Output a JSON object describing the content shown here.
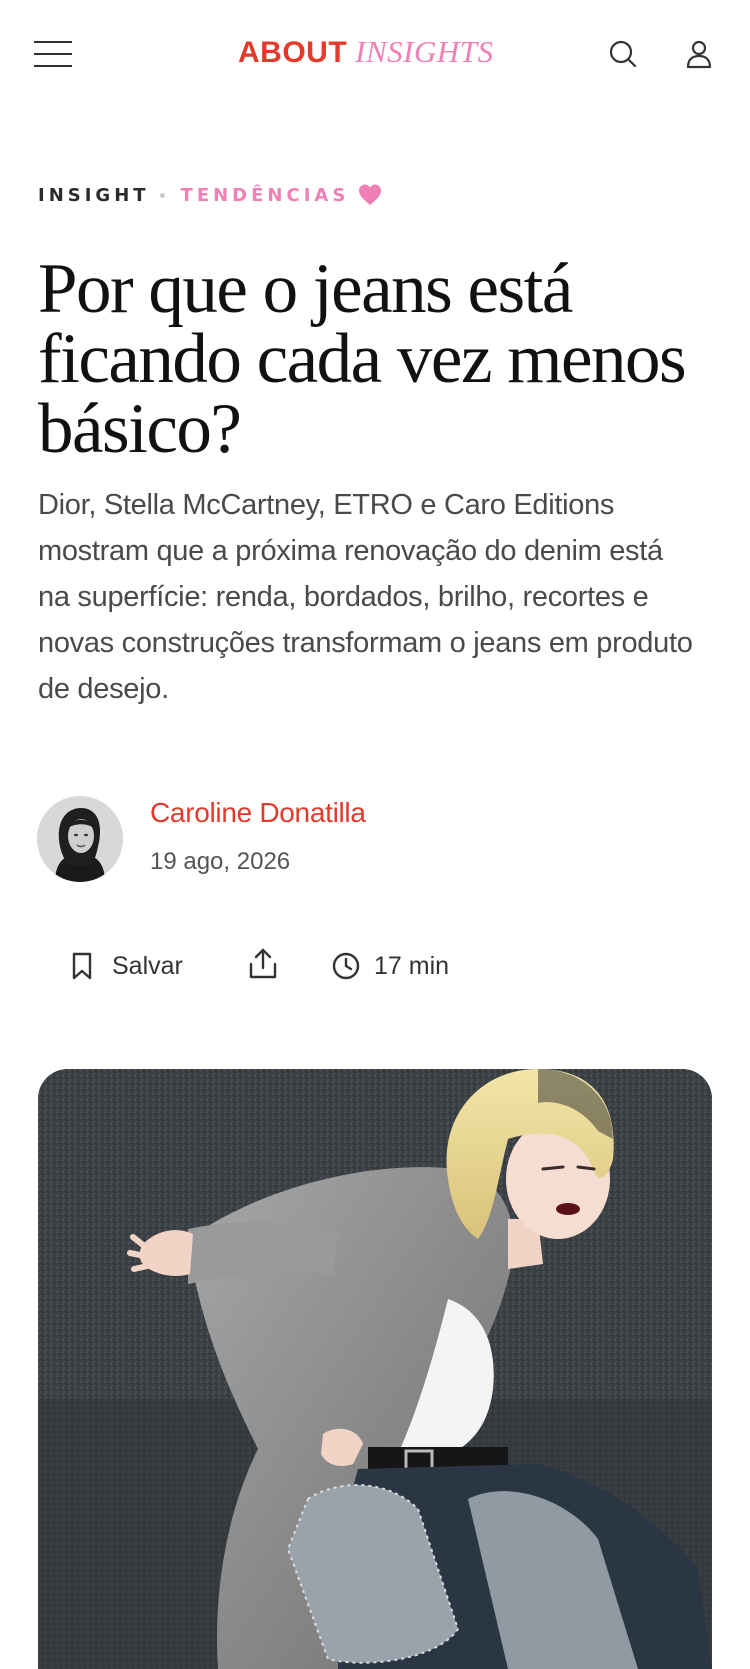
{
  "header": {
    "logo_primary": "ABOUT",
    "logo_secondary": "INSIGHTS",
    "menu_icon": "hamburger-menu-icon",
    "search_icon": "search-icon",
    "account_icon": "user-icon"
  },
  "article": {
    "category_primary": "INSIGHT",
    "category_secondary": "TENDÊNCIAS",
    "favorite_icon": "heart-icon",
    "title": "Por que o jeans está ficando cada vez menos básico?",
    "subtitle": "Dior, Stella McCartney, ETRO e Caro Editions mostram que a próxima renovação do denim está na superfície: renda, bordados, brilho, recortes e novas construções transformam o jeans em produto de desejo.",
    "author": {
      "name": "Caroline Donatilla",
      "date": "19 ago, 2026"
    },
    "actions": {
      "save_label": "Salvar",
      "save_icon": "bookmark-icon",
      "share_icon": "share-icon",
      "read_time": "17 min",
      "clock_icon": "clock-icon"
    },
    "hero_image": "hero-photo"
  },
  "colors": {
    "brand_red": "#e53a2b",
    "brand_pink": "#f07fb5",
    "text_dark": "#111111",
    "text_body": "#4a4a4a"
  }
}
